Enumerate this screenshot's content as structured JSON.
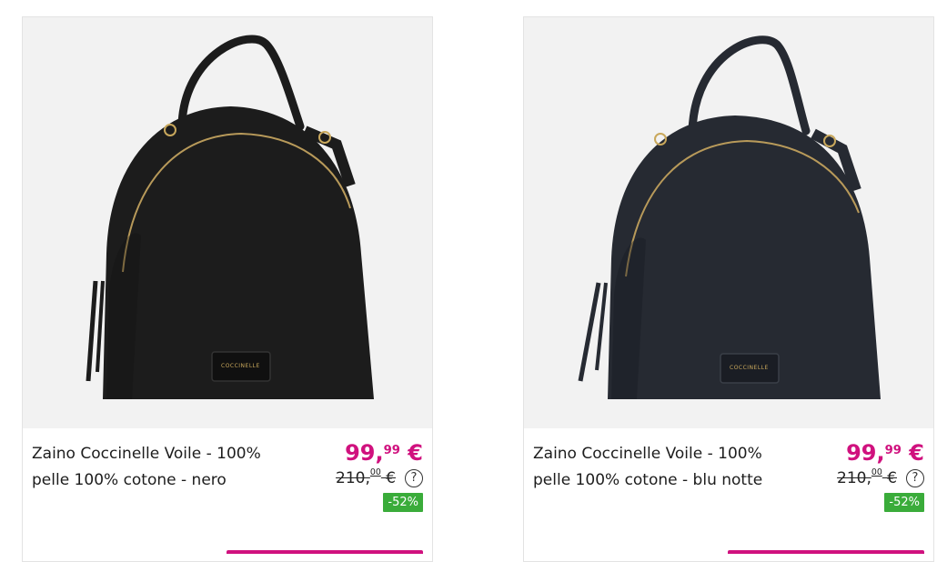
{
  "products": [
    {
      "title": "Zaino Coccinelle Voile - 100% pelle 100% cotone - nero",
      "price_main": "99,",
      "price_cents": "99",
      "price_currency": " €",
      "old_main": "210,",
      "old_cents": "00",
      "old_currency": " €",
      "help_symbol": "?",
      "discount": "-52%",
      "brand_tag": "COCCINELLE",
      "bag_color": "#1c1c1c"
    },
    {
      "title": "Zaino Coccinelle Voile - 100% pelle 100% cotone - blu notte",
      "price_main": "99,",
      "price_cents": "99",
      "price_currency": " €",
      "old_main": "210,",
      "old_cents": "00",
      "old_currency": " €",
      "help_symbol": "?",
      "discount": "-52%",
      "brand_tag": "COCCINELLE",
      "bag_color": "#262a32"
    }
  ],
  "colors": {
    "accent": "#d0117e",
    "discount_bg": "#3aac3a"
  }
}
